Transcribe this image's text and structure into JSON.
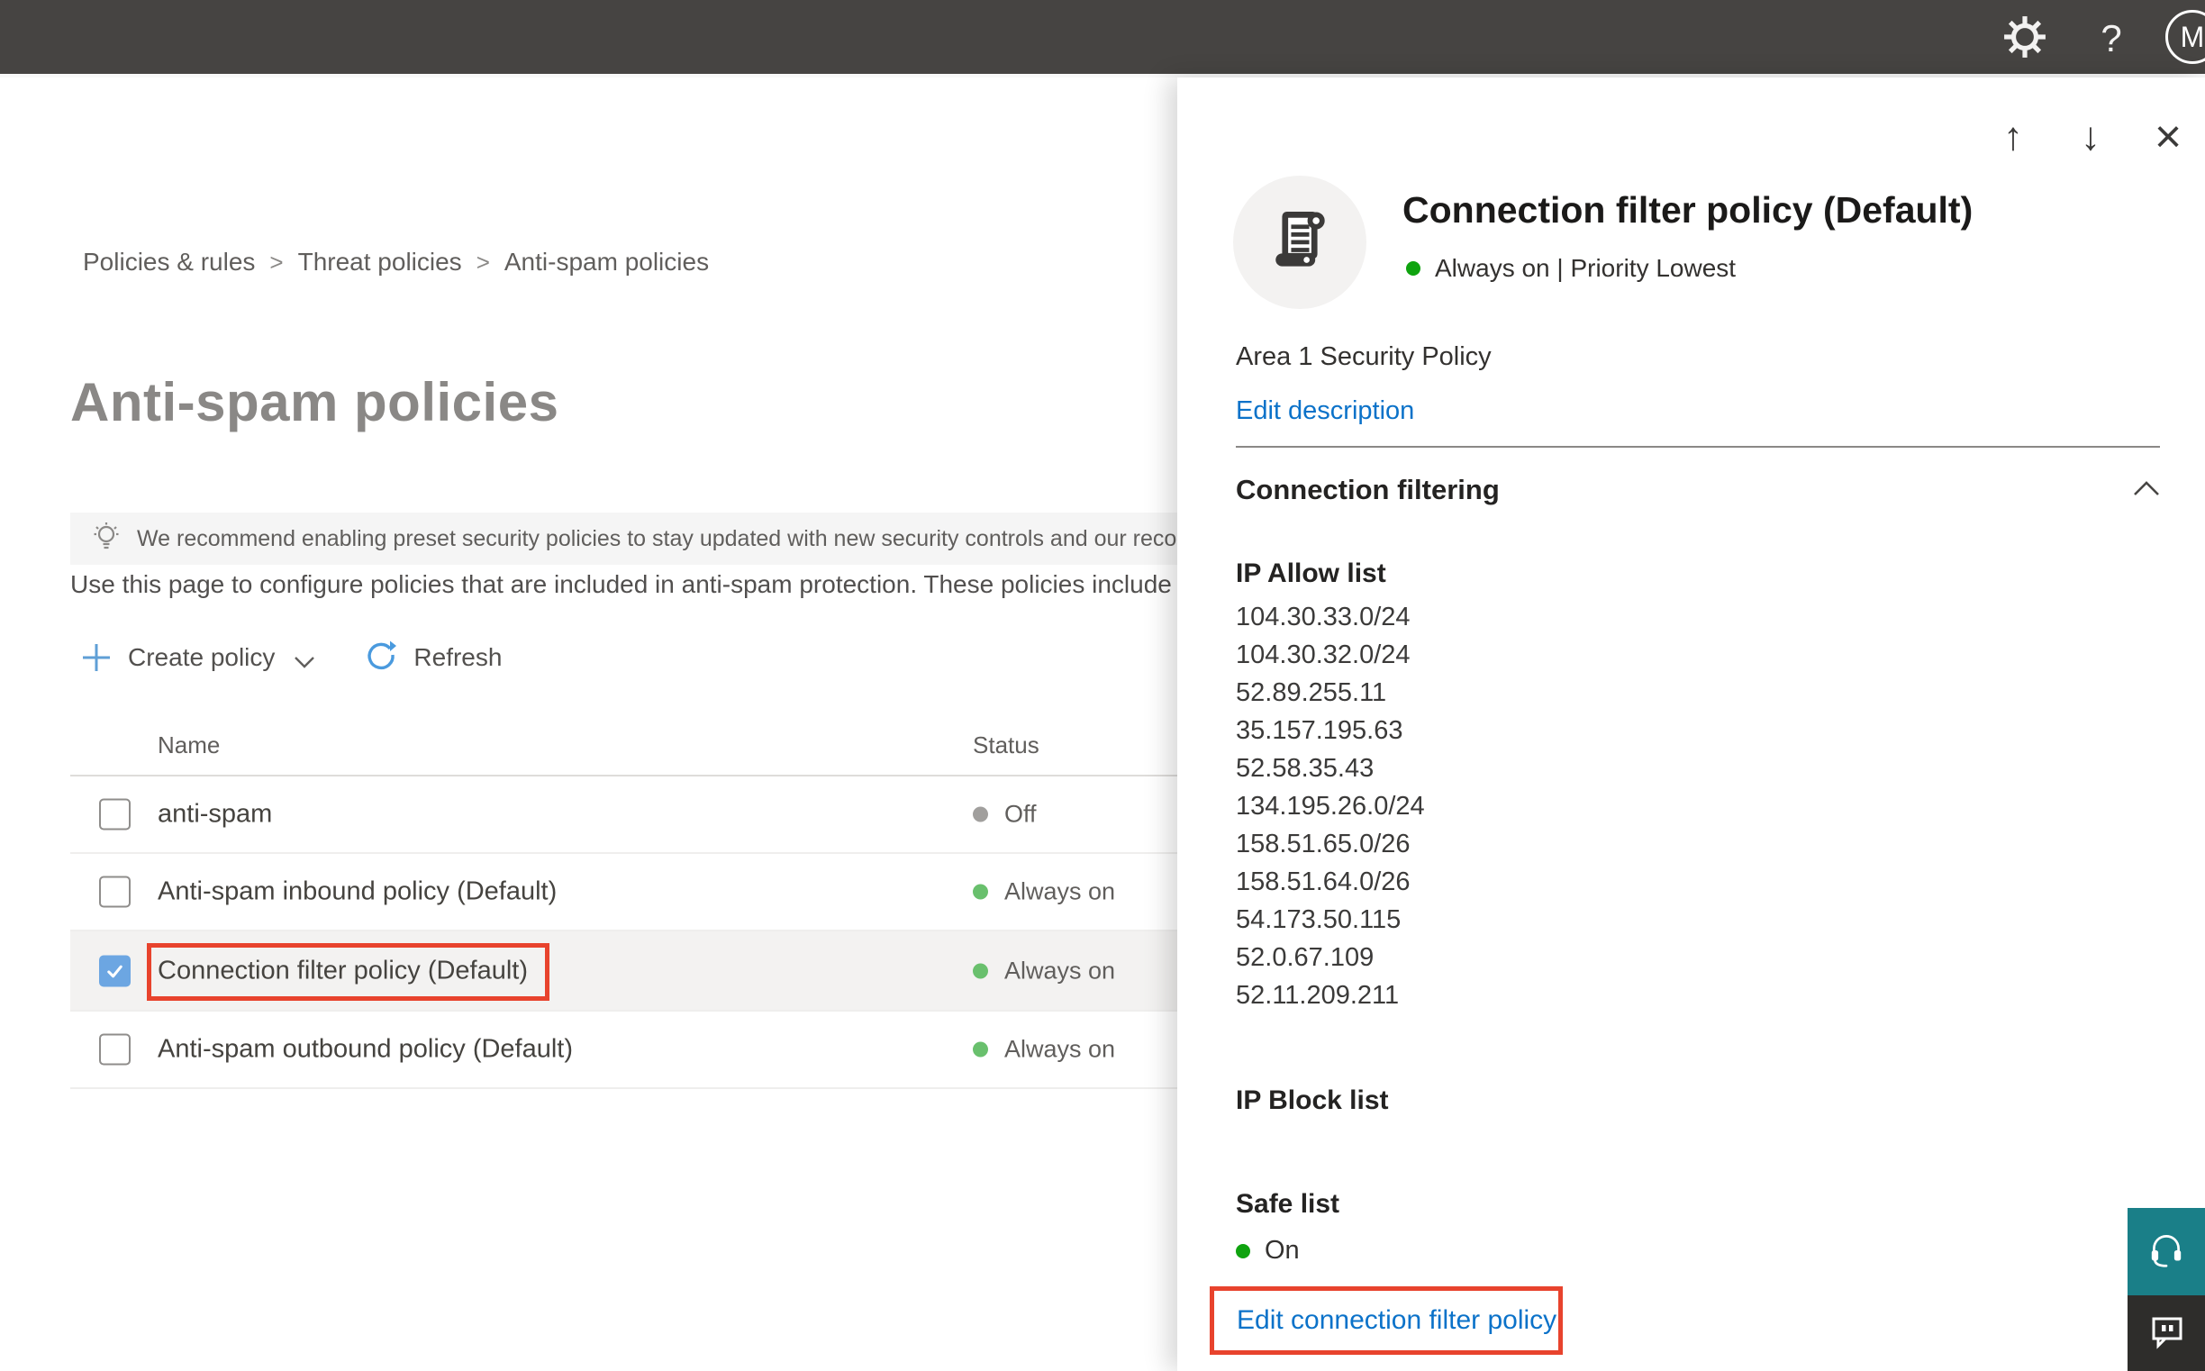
{
  "topbar": {
    "help_glyph": "?",
    "avatar_initial": "M"
  },
  "breadcrumb": {
    "separator": ">",
    "items": [
      "Policies & rules",
      "Threat policies",
      "Anti-spam policies"
    ]
  },
  "page": {
    "title": "Anti-spam policies",
    "banner_text": "We recommend enabling preset security policies to stay updated with new security controls and our recomme",
    "description": "Use this page to configure policies that are included in anti-spam protection. These policies include",
    "toolbar": {
      "create_policy_label": "Create policy",
      "refresh_label": "Refresh"
    }
  },
  "table": {
    "columns": [
      "Name",
      "Status"
    ],
    "rows": [
      {
        "name": "anti-spam",
        "status": "Off"
      },
      {
        "name": "Anti-spam inbound policy (Default)",
        "status": "Always on"
      },
      {
        "name": "Connection filter policy (Default)",
        "status": "Always on"
      },
      {
        "name": "Anti-spam outbound policy (Default)",
        "status": "Always on"
      }
    ]
  },
  "flyout": {
    "title": "Connection filter policy (Default)",
    "status_line": "Always on | Priority Lowest",
    "description": "Area 1 Security Policy",
    "edit_description_label": "Edit description",
    "section_title": "Connection filtering",
    "ip_allow_title": "IP Allow list",
    "ip_allow_list": [
      "104.30.33.0/24",
      "104.30.32.0/24",
      "52.89.255.11",
      "35.157.195.63",
      "52.58.35.43",
      "134.195.26.0/24",
      "158.51.65.0/26",
      "158.51.64.0/26",
      "54.173.50.115",
      "52.0.67.109",
      "52.11.209.211"
    ],
    "ip_block_title": "IP Block list",
    "safe_list_title": "Safe list",
    "safe_list_status": "On",
    "edit_policy_label": "Edit connection filter policy",
    "controls": {
      "up": "↑",
      "down": "↓",
      "close": "×"
    }
  },
  "colors": {
    "topbar-bg": "#464442",
    "accent-blue": "#3d96dd",
    "link-blue": "#0b72c9",
    "check-blue": "#6ca6e2",
    "annotation-red": "#e8432d",
    "green-soft": "#69c06d",
    "green-bright": "#0fa30f",
    "gray-dot": "#a19f9d",
    "teal-widget": "#1a7f88",
    "dark-widget": "#2e2d2b"
  }
}
